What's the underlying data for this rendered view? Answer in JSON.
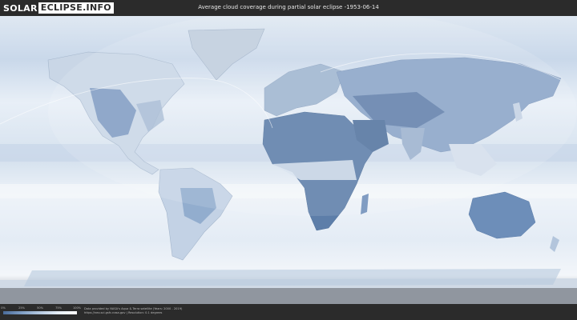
{
  "header": {
    "logo_solar": "SOLAR",
    "logo_rest": "ECLIPSE.INFO",
    "title": "Average cloud coverage during partial solar eclipse -1953-06-14"
  },
  "legend": {
    "ticks": [
      "0%",
      "25%",
      "50%",
      "75%",
      "100%"
    ],
    "colors": [
      "#4a6c9b",
      "#7e9dc4",
      "#b5c9e0",
      "#e6eef7",
      "#ffffff"
    ]
  },
  "credits": {
    "line1": "Data provided by NASA's Aqua & Terra satellite (Years: 2000 - 2019)",
    "line2": "https://neo.sci.gsfc.nasa.gov | Resolution: 0.1 degrees"
  },
  "colors": {
    "background": "#2b2b2b",
    "cloud_clear": "#4a6c9b",
    "cloud_full": "#ffffff"
  }
}
